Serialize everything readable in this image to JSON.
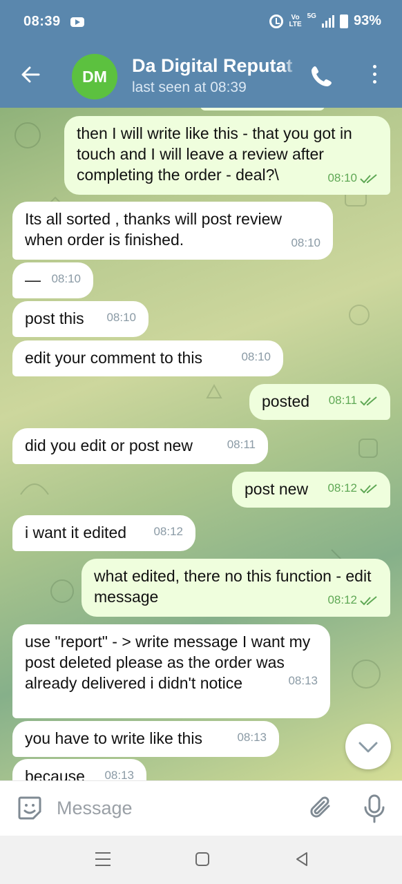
{
  "status_bar": {
    "time": "08:39",
    "volte_top": "Vo",
    "volte_bottom": "LTE",
    "network": "5G",
    "battery": "93%"
  },
  "header": {
    "avatar_initials": "DM",
    "avatar_color": "#5cc13f",
    "title": "Da Digital Reputat",
    "subtitle": "last seen at 08:39"
  },
  "colors": {
    "header_bg": "#5a87ad",
    "bubble_in": "#ffffff",
    "bubble_out": "#effedd",
    "time_out": "#5fa855"
  },
  "messages": [
    {
      "dir": "out",
      "text": "then I will write like this - that you got in touch and I will leave a review after completing the order - deal?\\",
      "time": "08:10",
      "read": true
    },
    {
      "dir": "in",
      "text": "Its all sorted , thanks will post review when order is finished.",
      "time": "08:10"
    },
    {
      "dir": "in",
      "text": "—",
      "time": "08:10"
    },
    {
      "dir": "in",
      "text": "post this",
      "time": "08:10"
    },
    {
      "dir": "in",
      "text": "edit your comment to this",
      "time": "08:10"
    },
    {
      "dir": "out",
      "text": "posted",
      "time": "08:11",
      "read": true
    },
    {
      "dir": "in",
      "text": "did you edit or post new",
      "time": "08:11"
    },
    {
      "dir": "out",
      "text": "post new",
      "time": "08:12",
      "read": true
    },
    {
      "dir": "in",
      "text": "i want it edited",
      "time": "08:12"
    },
    {
      "dir": "out",
      "text": "what edited, there no this function - edit message",
      "time": "08:12",
      "read": true
    },
    {
      "dir": "in",
      "text": "use \"report\" - > write message I want my post deleted please as the order was already delivered i didn't notice",
      "time": "08:13"
    },
    {
      "dir": "in",
      "text": "you have to write like this",
      "time": "08:13"
    },
    {
      "dir": "in",
      "text": "because",
      "time": "08:13"
    }
  ],
  "composer": {
    "placeholder": "Message"
  },
  "icons": {
    "back": "arrow-left-icon",
    "call": "phone-icon",
    "more": "more-vertical-icon",
    "emoji": "emoji-sticker-icon",
    "attach": "paperclip-icon",
    "mic": "microphone-icon",
    "scroll_down": "chevron-down-icon"
  }
}
